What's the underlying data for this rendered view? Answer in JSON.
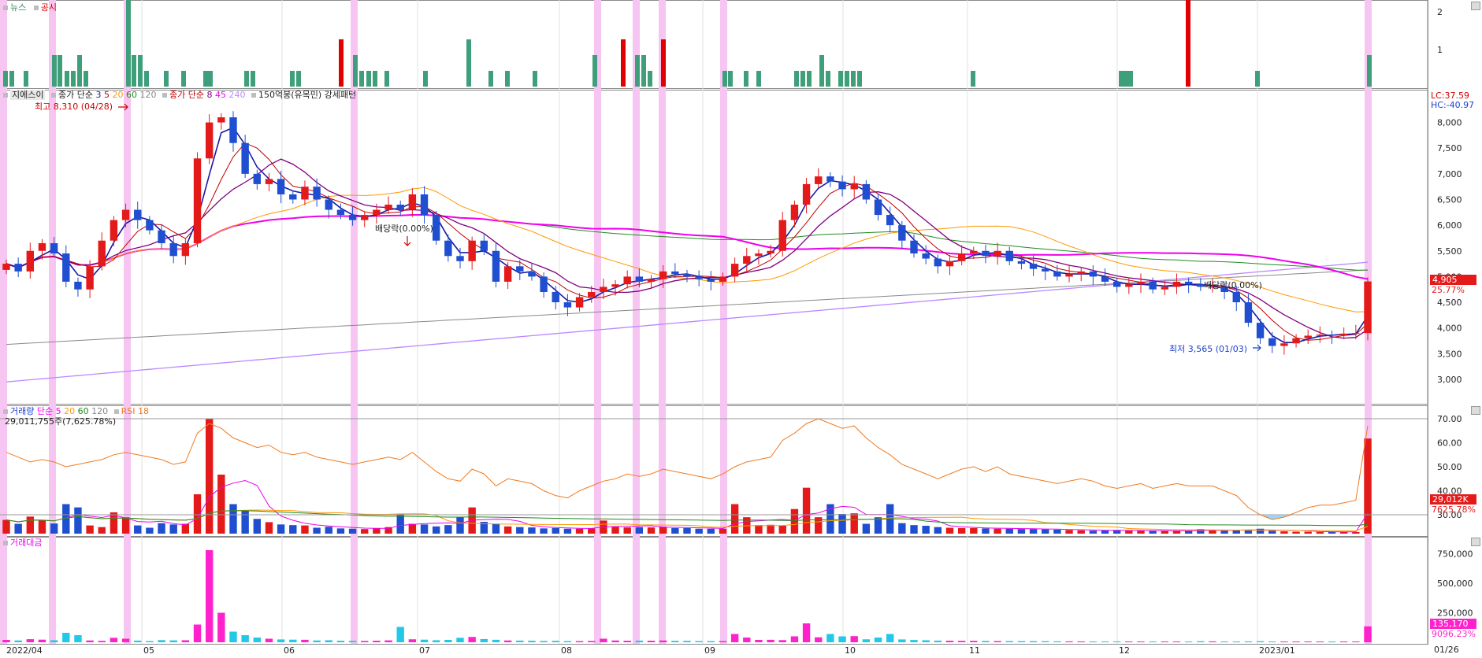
{
  "news_panel": {
    "legend": [
      {
        "label": "뉴스",
        "color": "#2e8b57"
      },
      {
        "label": "공시",
        "color": "#e00000"
      }
    ],
    "ticks": [
      "2",
      "1"
    ]
  },
  "price_panel": {
    "name": "지에스이",
    "ma_short": {
      "label": "종가 단순",
      "periods": [
        "3",
        "5",
        "20",
        "60",
        "120"
      ],
      "colors": [
        "#1a1aa6",
        "#c00000",
        "#ff9900",
        "#228b22",
        "#888888"
      ]
    },
    "ma_long": {
      "label": "종가 단순",
      "periods": [
        "8",
        "45",
        "240"
      ],
      "colors": [
        "#800080",
        "#ee00ee",
        "#bb88ff"
      ]
    },
    "pattern_label": "150억봉(유목민) 강세패턴",
    "lc": "LC:37.59",
    "hc": "HC:-40.97",
    "high_label": "최고 8,310 (04/28)",
    "low_label": "최저 3,565 (01/03)",
    "div_label_1": "배당락(0.00%)",
    "div_label_2": "배당락(0.00%)",
    "current_price": "4,905",
    "current_change": "25.77%",
    "yticks": [
      "8,000",
      "7,500",
      "7,000",
      "6,500",
      "6,000",
      "5,500",
      "5,000",
      "4,500",
      "4,000",
      "3,500",
      "3,000"
    ]
  },
  "volume_panel": {
    "legend_vol": "거래량",
    "legend_ma": {
      "label": "단순",
      "periods": [
        "5",
        "20",
        "60",
        "120"
      ],
      "colors": [
        "#ee00ee",
        "#ff9900",
        "#228b22",
        "#888888"
      ]
    },
    "legend_rsi": "RSI 18",
    "value_text": "29,011,755주(7,625.78%)",
    "current_volume": "29,012K",
    "current_pct": "7625.78%",
    "yticks": [
      "70.00",
      "60.00",
      "50.00",
      "40.00",
      "30.00"
    ]
  },
  "amount_panel": {
    "legend": "거래대금",
    "current_amount": "135,170",
    "current_pct": "9096.23%",
    "yticks": [
      "750,000",
      "500,000",
      "250,000"
    ]
  },
  "x_axis": {
    "labels": [
      "2022/04",
      "05",
      "06",
      "07",
      "08",
      "09",
      "10",
      "11",
      "12",
      "2023/01"
    ],
    "right_label": "01/26"
  },
  "colors": {
    "up": "#e41a1a",
    "down": "#1f4fd0",
    "highlight": "#f7c5f2",
    "rsi": "#f07a20",
    "news": "#3f9f7a",
    "amount_up": "#ff22cc",
    "amount_down": "#22c8e8"
  },
  "chart_data": {
    "type": "candlestick",
    "period": "2022/04 - 2023/01/26",
    "x_labels": [
      "2022/04",
      "05",
      "06",
      "07",
      "08",
      "09",
      "10",
      "11",
      "12",
      "2023/01"
    ],
    "price_ylim": [
      2800,
      8300
    ],
    "high": {
      "value": 8310,
      "date": "04/28"
    },
    "low": {
      "value": 3565,
      "date": "01/03"
    },
    "last_close": 4905,
    "last_change_pct": 25.77,
    "close_series": [
      5250,
      5100,
      5500,
      5650,
      5450,
      4900,
      4750,
      5200,
      5700,
      6100,
      6300,
      6100,
      5900,
      5650,
      5400,
      5650,
      7300,
      8000,
      8100,
      7600,
      7000,
      6800,
      6900,
      6600,
      6500,
      6750,
      6500,
      6300,
      6200,
      6100,
      6200,
      6300,
      6400,
      6300,
      6600,
      6200,
      5700,
      5400,
      5300,
      5700,
      5500,
      4900,
      5200,
      5100,
      5000,
      4700,
      4500,
      4400,
      4600,
      4700,
      4800,
      4850,
      5000,
      4900,
      4950,
      5100,
      5050,
      5000,
      4950,
      4900,
      5000,
      5250,
      5400,
      5450,
      5500,
      6100,
      6400,
      6800,
      6950,
      6850,
      6700,
      6800,
      6500,
      6200,
      6000,
      5700,
      5450,
      5350,
      5200,
      5300,
      5450,
      5500,
      5400,
      5500,
      5300,
      5250,
      5150,
      5100,
      5000,
      5050,
      5100,
      5000,
      4900,
      4800,
      4850,
      4900,
      4750,
      4800,
      4900,
      4850,
      4800,
      4800,
      4700,
      4500,
      4100,
      3800,
      3650,
      3700,
      3800,
      3850,
      3870,
      3860,
      3890,
      3900,
      4905
    ],
    "volume_kshares": [
      4200,
      3000,
      5200,
      4000,
      3100,
      9000,
      8000,
      2500,
      2000,
      6500,
      5000,
      2500,
      1800,
      3200,
      2800,
      3000,
      12000,
      35000,
      18000,
      9000,
      7000,
      4500,
      3500,
      2800,
      2600,
      2500,
      1800,
      2100,
      1600,
      1500,
      1400,
      1600,
      2000,
      6000,
      3000,
      2800,
      2200,
      2600,
      5000,
      8000,
      3600,
      2900,
      2200,
      2000,
      1900,
      1600,
      1700,
      1500,
      1500,
      1600,
      4000,
      2200,
      1900,
      2000,
      1900,
      2100,
      1700,
      1700,
      1500,
      1500,
      1500,
      9000,
      5000,
      2600,
      2700,
      2400,
      7500,
      14000,
      5000,
      9000,
      6000,
      6200,
      3000,
      5000,
      9000,
      3200,
      2600,
      2400,
      2000,
      1800,
      1700,
      1700,
      1600,
      1500,
      1500,
      1400,
      1400,
      1300,
      1200,
      1100,
      1000,
      900,
      1000,
      1100,
      900,
      900,
      800,
      800,
      900,
      900,
      1400,
      1100,
      900,
      1000,
      1200,
      1500,
      900,
      700,
      600,
      600,
      500,
      500,
      500,
      500,
      29012
    ],
    "rsi18": [
      56,
      54,
      52,
      53,
      52,
      50,
      51,
      52,
      53,
      55,
      56,
      55,
      54,
      53,
      51,
      52,
      64,
      68,
      66,
      62,
      60,
      58,
      59,
      56,
      55,
      56,
      54,
      53,
      52,
      51,
      52,
      53,
      54,
      53,
      56,
      52,
      48,
      45,
      44,
      49,
      47,
      42,
      45,
      44,
      43,
      40,
      38,
      37,
      40,
      42,
      44,
      45,
      47,
      46,
      47,
      49,
      48,
      47,
      46,
      45,
      47,
      50,
      52,
      53,
      54,
      61,
      64,
      68,
      70,
      68,
      66,
      67,
      62,
      58,
      55,
      51,
      49,
      47,
      45,
      47,
      49,
      50,
      48,
      50,
      47,
      46,
      45,
      44,
      43,
      44,
      45,
      44,
      42,
      41,
      42,
      43,
      41,
      42,
      43,
      42,
      42,
      42,
      40,
      38,
      33,
      30,
      28,
      29,
      31,
      33,
      34,
      34,
      35,
      36,
      67
    ],
    "amount_mwon": [
      20000,
      15000,
      26000,
      22000,
      17000,
      80000,
      60000,
      15000,
      12000,
      38000,
      30000,
      14000,
      10000,
      18000,
      16000,
      17000,
      150000,
      780000,
      250000,
      90000,
      60000,
      40000,
      30000,
      24000,
      22000,
      21000,
      15000,
      17000,
      13000,
      12000,
      11000,
      13000,
      16000,
      130000,
      25000,
      22000,
      17000,
      20000,
      38000,
      45000,
      27000,
      21000,
      15000,
      14000,
      13000,
      11000,
      12000,
      10000,
      10000,
      11000,
      30000,
      15000,
      13000,
      14000,
      13000,
      15000,
      12000,
      12000,
      10000,
      10000,
      10000,
      70000,
      40000,
      20000,
      21000,
      18000,
      50000,
      160000,
      42000,
      70000,
      50000,
      52000,
      25000,
      40000,
      70000,
      24000,
      19000,
      17000,
      14000,
      13000,
      12000,
      12000,
      11000,
      10000,
      10000,
      9500,
      9500,
      9000,
      8000,
      7500,
      7000,
      6200,
      7000,
      7500,
      6200,
      6200,
      5500,
      5500,
      6200,
      6200,
      9000,
      7500,
      6000,
      6500,
      7500,
      9000,
      5500,
      4200,
      3600,
      3600,
      3000,
      3000,
      3000,
      3000,
      135170
    ]
  }
}
